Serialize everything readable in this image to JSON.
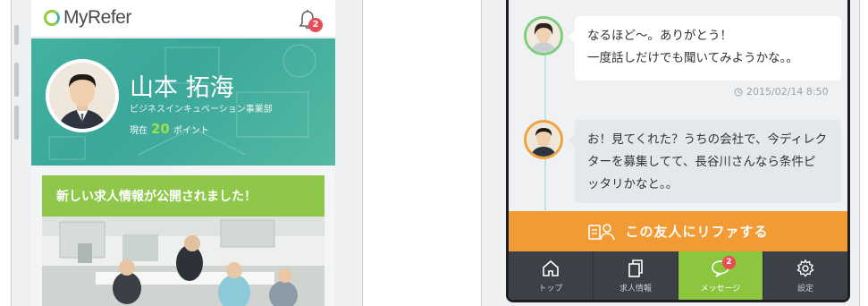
{
  "left_app": {
    "logo_text": "MyRefer",
    "notification_count": "2",
    "profile": {
      "name": "山本 拓海",
      "department": "ビジネスインキュベーション事業部",
      "points_prefix": "現在",
      "points_value": "20",
      "points_suffix": "ポイント"
    },
    "news_card": {
      "headline": "新しい求人情報が公開されました！"
    }
  },
  "right_app": {
    "messages": [
      {
        "text_line1": "なるほど〜。ありがとう！",
        "text_line2": "一度話しだけでも聞いてみようかな。。",
        "timestamp": "2015/02/14 8:50"
      },
      {
        "text_line1": "お！見てくれた？うちの会社で、今ディレク",
        "text_line2": "ターを募集してて、長谷川さんなら条件ピ",
        "text_line3": "ッタリかなと。。"
      }
    ],
    "refer_button_label": "この友人にリファする",
    "tabs": [
      {
        "label": "トップ",
        "icon": "home-icon"
      },
      {
        "label": "求人情報",
        "icon": "documents-icon"
      },
      {
        "label": "メッセージ",
        "icon": "chat-icon",
        "badge": "2",
        "active": true
      },
      {
        "label": "設定",
        "icon": "gear-icon"
      }
    ]
  },
  "colors": {
    "brand_green": "#8cc63f",
    "teal": "#43b2a0",
    "orange": "#f29a33",
    "badge_red": "#e94b57",
    "tabbar_dark": "#3c4148"
  }
}
